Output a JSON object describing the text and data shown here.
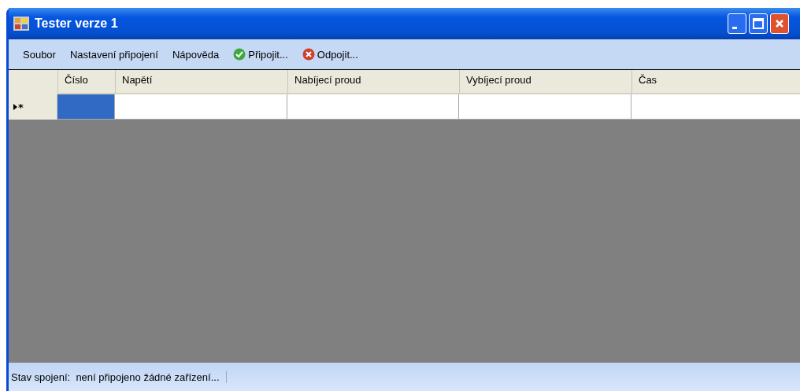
{
  "window": {
    "title": "Tester verze 1"
  },
  "menu": [
    {
      "label": "Soubor",
      "kind": "plain"
    },
    {
      "label": "Nastavení připojení",
      "kind": "plain"
    },
    {
      "label": "Nápověda",
      "kind": "plain"
    },
    {
      "label": "Připojit...",
      "kind": "check"
    },
    {
      "label": "Odpojit...",
      "kind": "cross"
    }
  ],
  "table": {
    "columns": [
      "Číslo",
      "Napětí",
      "Nabíjecí proud",
      "Vybíjecí proud",
      "Čas"
    ],
    "rows": [
      {
        "marker": "*",
        "current": true,
        "cells": [
          {
            "selected": true
          },
          {
            "selected": false
          },
          {
            "selected": false
          },
          {
            "selected": false
          },
          {
            "selected": false
          }
        ]
      }
    ]
  },
  "status_bar": {
    "label": "Stav spojení:",
    "value": "není připojeno žádné zařízení..."
  }
}
